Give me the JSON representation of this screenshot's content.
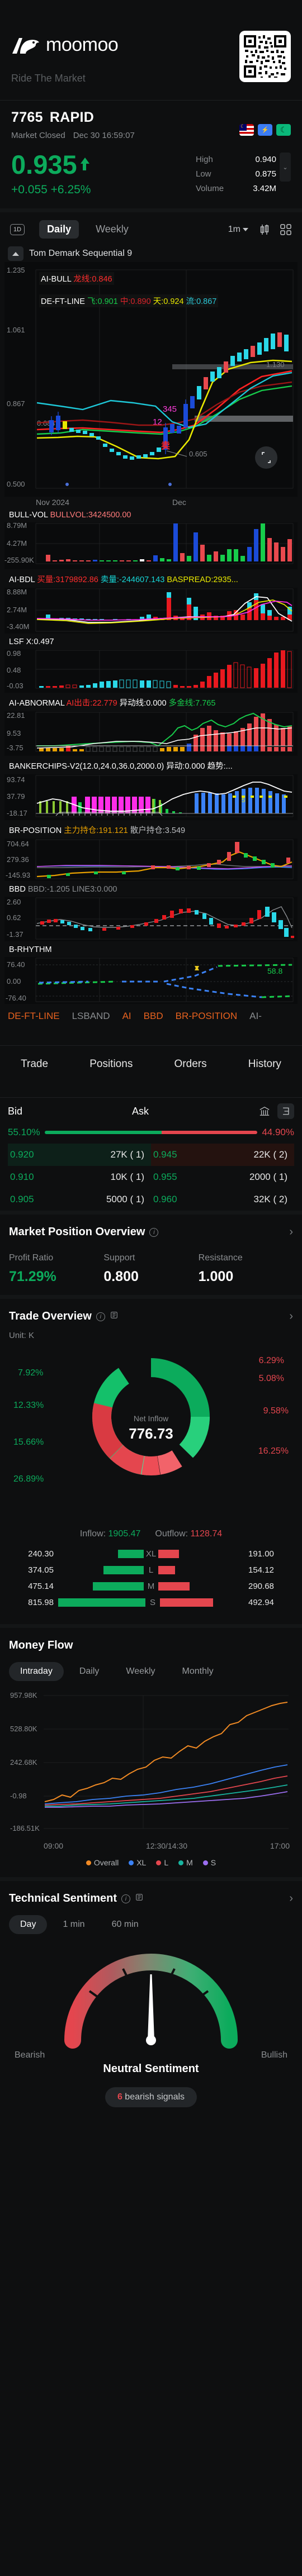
{
  "brand": {
    "name": "moomoo",
    "tagline": "Ride The Market",
    "logo_icon": "moomoo-bull-logo",
    "qr_icon": "qr-code"
  },
  "ticker": {
    "code": "7765",
    "name": "RAPID",
    "market_status": "Market Closed",
    "timestamp": "Dec 30 16:59:07",
    "price": "0.935",
    "change": "+0.055",
    "change_pct": "+6.25%",
    "trend_icon": "arrow-up",
    "badges": [
      "flag-malaysia",
      "level-2-icon",
      "moon-icon"
    ],
    "stats": [
      {
        "label": "High",
        "value": "0.940"
      },
      {
        "label": "Low",
        "value": "0.875"
      },
      {
        "label": "Volume",
        "value": "3.42M"
      }
    ],
    "expand_icon": "chevron-down-icon"
  },
  "chart_toolbar": {
    "range_btn": "1D",
    "tabs": [
      {
        "label": "Daily",
        "active": true
      },
      {
        "label": "Weekly",
        "active": false
      }
    ],
    "interval": "1m",
    "candle_icon": "candlestick-icon",
    "grid_icon": "grid-layout-icon"
  },
  "chart_data": {
    "type": "line",
    "title": "Tom Demark Sequential 9",
    "xlabel": "",
    "ylabel": "",
    "x_ticks": [
      "Nov 2024",
      "Dec"
    ],
    "main_panel": {
      "y_max": "1.235",
      "y_mid": "1.061",
      "y_low": "0.867",
      "y_min": "0.500",
      "right_label": "1.130",
      "marker_labels": [
        "0.684",
        "0.605",
        "345",
        "12"
      ],
      "overlays": [
        {
          "name": "AI-BULL",
          "fields": [
            {
              "text": "龙线:0.846",
              "color": "#ff2d2d"
            }
          ]
        },
        {
          "name": "DE-FT-LINE",
          "fields": [
            {
              "text": "飞:0.901",
              "color": "#17cc4b"
            },
            {
              "text": "中:0.890",
              "color": "#d8232a"
            },
            {
              "text": "天:0.924",
              "color": "#e8e800"
            },
            {
              "text": "流:0.867",
              "color": "#2bc8d8"
            }
          ]
        }
      ]
    },
    "sub_panels": [
      {
        "name": "BULL-VOL",
        "fields": [
          {
            "text": "BULLVOL:3424500.00",
            "color": "#ff7b7b"
          }
        ],
        "y_labels": [
          "8.79M",
          "4.27M",
          "-255.90K"
        ],
        "type": "bar"
      },
      {
        "name": "AI-BDL",
        "fields": [
          {
            "text": "买量:3179892.86",
            "color": "#ff2d2d"
          },
          {
            "text": "卖量:-244607.143",
            "color": "#17d8d8"
          },
          {
            "text": "BASPREAD:2935...",
            "color": "#e8e800"
          }
        ],
        "y_labels": [
          "8.88M",
          "2.74M",
          "-3.40M"
        ],
        "type": "bar"
      },
      {
        "name": "LSF",
        "fields": [
          {
            "text": "X:0.497",
            "color": "#ffffff"
          }
        ],
        "y_labels": [
          "0.98",
          "0.48",
          "-0.03"
        ],
        "type": "bar"
      },
      {
        "name": "AI-ABNORMAL",
        "fields": [
          {
            "text": "AI出击:22.779",
            "color": "#ff2d2d"
          },
          {
            "text": "异动线:0.000",
            "color": "#ffffff"
          },
          {
            "text": "多金线:7.765",
            "color": "#17cc4b"
          }
        ],
        "y_labels": [
          "22.81",
          "9.53",
          "-3.75"
        ],
        "type": "bar"
      },
      {
        "name": "BANKERCHIPS-V2(12.0,24.0,36.0,2000.0)",
        "fields": [
          {
            "text": "异动:0.000",
            "color": "#ffffff"
          },
          {
            "text": "趋势:...",
            "color": "#ffffff"
          }
        ],
        "y_labels": [
          "93.74",
          "37.79",
          "-18.17"
        ],
        "type": "bar"
      },
      {
        "name": "BR-POSITION",
        "fields": [
          {
            "text": "主力持仓:191.121",
            "color": "#e8a000"
          },
          {
            "text": "散户持仓:3.549",
            "color": "#bdbfc2"
          }
        ],
        "y_labels": [
          "704.64",
          "279.36",
          "-145.93"
        ],
        "type": "line"
      },
      {
        "name": "BBD",
        "fields": [
          {
            "text": "BBD:-1.205",
            "color": "#8a8d90"
          },
          {
            "text": "LINE3:0.000",
            "color": "#8a8d90"
          }
        ],
        "y_labels": [
          "2.60",
          "0.62",
          "-1.37"
        ],
        "type": "line"
      },
      {
        "name": "B-RHYTHM",
        "fields": [],
        "y_labels": [
          "76.40",
          "0.00",
          "-76.40"
        ],
        "value_label": "58.8",
        "type": "line"
      }
    ]
  },
  "indicator_tabs": [
    {
      "label": "DE-FT-LINE",
      "active": true
    },
    {
      "label": "LSBAND",
      "active": false
    },
    {
      "label": "AI",
      "active": true
    },
    {
      "label": "BBD",
      "active": true
    },
    {
      "label": "BR-POSITION",
      "active": true
    },
    {
      "label": "AI-",
      "active": false
    }
  ],
  "trade_tabs": [
    "Trade",
    "Positions",
    "Orders",
    "History"
  ],
  "order_book": {
    "bid_header": "Bid",
    "ask_header": "Ask",
    "bank_icon": "bank-icon",
    "depth_icon": "depth-levels-icon",
    "bid_pct": "55.10%",
    "ask_pct": "44.90%",
    "bid_ratio": 55.1,
    "rows": [
      {
        "bid_price": "0.920",
        "bid_qty": "27K (",
        "bid_cnt": "1)",
        "ask_price": "0.945",
        "ask_qty": "22K (",
        "ask_cnt": "2)",
        "highlight": true
      },
      {
        "bid_price": "0.910",
        "bid_qty": "10K (",
        "bid_cnt": "1)",
        "ask_price": "0.955",
        "ask_qty": "2000 (",
        "ask_cnt": "1)",
        "highlight": false
      },
      {
        "bid_price": "0.905",
        "bid_qty": "5000 (",
        "bid_cnt": "1)",
        "ask_price": "0.960",
        "ask_qty": "32K (",
        "ask_cnt": "2)",
        "highlight": false
      }
    ]
  },
  "market_position": {
    "title": "Market Position Overview",
    "info_icon": "info-icon",
    "chevron_icon": "chevron-right-icon",
    "items": [
      {
        "label": "Profit Ratio",
        "value": "71.29%",
        "green": true
      },
      {
        "label": "Support",
        "value": "0.800",
        "green": false
      },
      {
        "label": "Resistance",
        "value": "1.000",
        "green": false
      }
    ]
  },
  "trade_overview": {
    "title": "Trade Overview",
    "info_icon": "info-icon",
    "copy_icon": "screenshot-icon",
    "chevron_icon": "chevron-right-icon",
    "unit": "Unit: K",
    "center_label": "Net Inflow",
    "center_value": "776.73",
    "left_labels": [
      "7.92%",
      "12.33%",
      "15.66%",
      "26.89%"
    ],
    "right_labels": [
      "6.29%",
      "5.08%",
      "9.58%",
      "16.25%"
    ],
    "inflow_label": "Inflow:",
    "inflow_value": "1905.47",
    "outflow_label": "Outflow:",
    "outflow_value": "1128.74",
    "rows": [
      {
        "left": "240.30",
        "tag": "XL",
        "right": "191.00",
        "lw": 46,
        "rw": 37
      },
      {
        "left": "374.05",
        "tag": "L",
        "right": "154.12",
        "lw": 72,
        "rw": 30
      },
      {
        "left": "475.14",
        "tag": "M",
        "right": "290.68",
        "lw": 91,
        "rw": 56
      },
      {
        "left": "815.98",
        "tag": "S",
        "right": "492.94",
        "lw": 156,
        "rw": 95
      }
    ]
  },
  "money_flow": {
    "title": "Money Flow",
    "tabs": [
      {
        "label": "Intraday",
        "active": true
      },
      {
        "label": "Daily",
        "active": false
      },
      {
        "label": "Weekly",
        "active": false
      },
      {
        "label": "Monthly",
        "active": false
      }
    ],
    "y_labels": [
      "957.98K",
      "528.80K",
      "242.68K",
      "-0.98",
      "-186.51K"
    ],
    "x_labels": [
      "09:00",
      "12:30/14:30",
      "17:00"
    ],
    "legend": [
      {
        "label": "Overall",
        "color": "#f08a24"
      },
      {
        "label": "XL",
        "color": "#3b82f6"
      },
      {
        "label": "L",
        "color": "#e4464e"
      },
      {
        "label": "M",
        "color": "#18b5a0"
      },
      {
        "label": "S",
        "color": "#9b6ef0"
      }
    ]
  },
  "technical_sentiment": {
    "title": "Technical Sentiment",
    "info_icon": "info-icon",
    "copy_icon": "screenshot-icon",
    "chevron_icon": "chevron-right-icon",
    "tabs": [
      {
        "label": "Day",
        "active": true
      },
      {
        "label": "1 min",
        "active": false
      },
      {
        "label": "60 min",
        "active": false
      }
    ],
    "left_label": "Bearish",
    "right_label": "Bullish",
    "result": "Neutral Sentiment",
    "signal_count": "6",
    "signal_text": " bearish signals"
  },
  "colors": {
    "up": "#0cab5c",
    "down": "#e4464e",
    "accent": "#e8621f",
    "bg": "#0e0f10"
  }
}
